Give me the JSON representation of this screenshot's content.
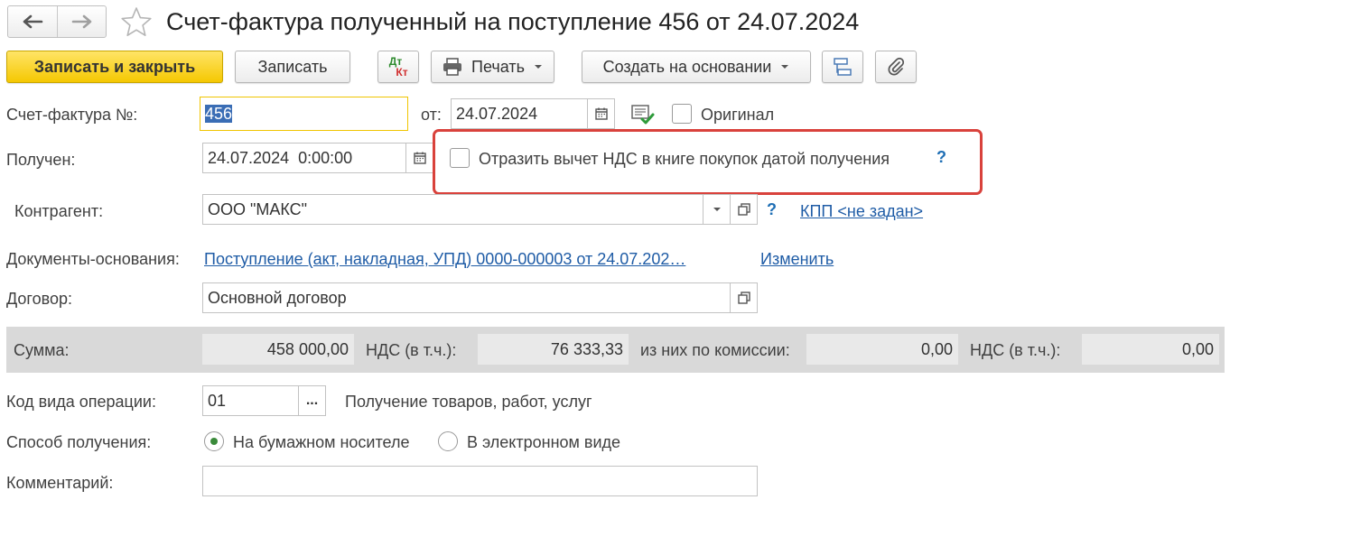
{
  "header": {
    "title": "Счет-фактура полученный на поступление 456 от 24.07.2024",
    "back_icon": "arrow-left-icon",
    "forward_icon": "arrow-right-icon",
    "favorite_icon": "star-icon"
  },
  "toolbar": {
    "save_close_label": "Записать и закрыть",
    "save_label": "Записать",
    "dtkt_top": "Дт",
    "dtkt_bottom": "Кт",
    "print_label": "Печать",
    "create_basis_label": "Создать на основании"
  },
  "form": {
    "invoice_number_label": "Счет-фактура №:",
    "invoice_number_value": "456",
    "date_from_label": "от:",
    "date_from_value": "24.07.2024",
    "original_label": "Оригинал",
    "received_label": "Получен:",
    "received_value": "24.07.2024  0:00:00",
    "vat_deduction_label": "Отразить вычет НДС в книге покупок датой получения",
    "help_mark": "?",
    "counterparty_label": "Контрагент:",
    "counterparty_value": "ООО \"МАКС\"",
    "kpp_link": "КПП <не задан>",
    "basis_docs_label": "Документы-основания:",
    "basis_docs_link": "Поступление (акт, накладная, УПД) 0000-000003 от 24.07.202…",
    "change_link": "Изменить",
    "contract_label": "Договор:",
    "contract_value": "Основной договор",
    "op_code_label": "Код вида операции:",
    "op_code_value": "01",
    "op_code_button": "...",
    "op_code_desc": "Получение товаров, работ, услуг",
    "receive_method_label": "Способ получения:",
    "paper_label": "На бумажном носителе",
    "electronic_label": "В электронном виде",
    "comment_label": "Комментарий:",
    "comment_value": ""
  },
  "sums": {
    "sum_label": "Сумма:",
    "sum_value": "458 000,00",
    "vat_label": "НДС (в т.ч.):",
    "vat_value": "76 333,33",
    "commission_label": "из них по комиссии:",
    "commission_value": "0,00",
    "commission_vat_label": "НДС (в т.ч.):",
    "commission_vat_value": "0,00"
  },
  "colors": {
    "primary_button": "#f5c802",
    "highlight_border": "#d9423c",
    "link": "#1f5ca6",
    "focus_border": "#f0c500",
    "selection": "#3a6db5"
  }
}
